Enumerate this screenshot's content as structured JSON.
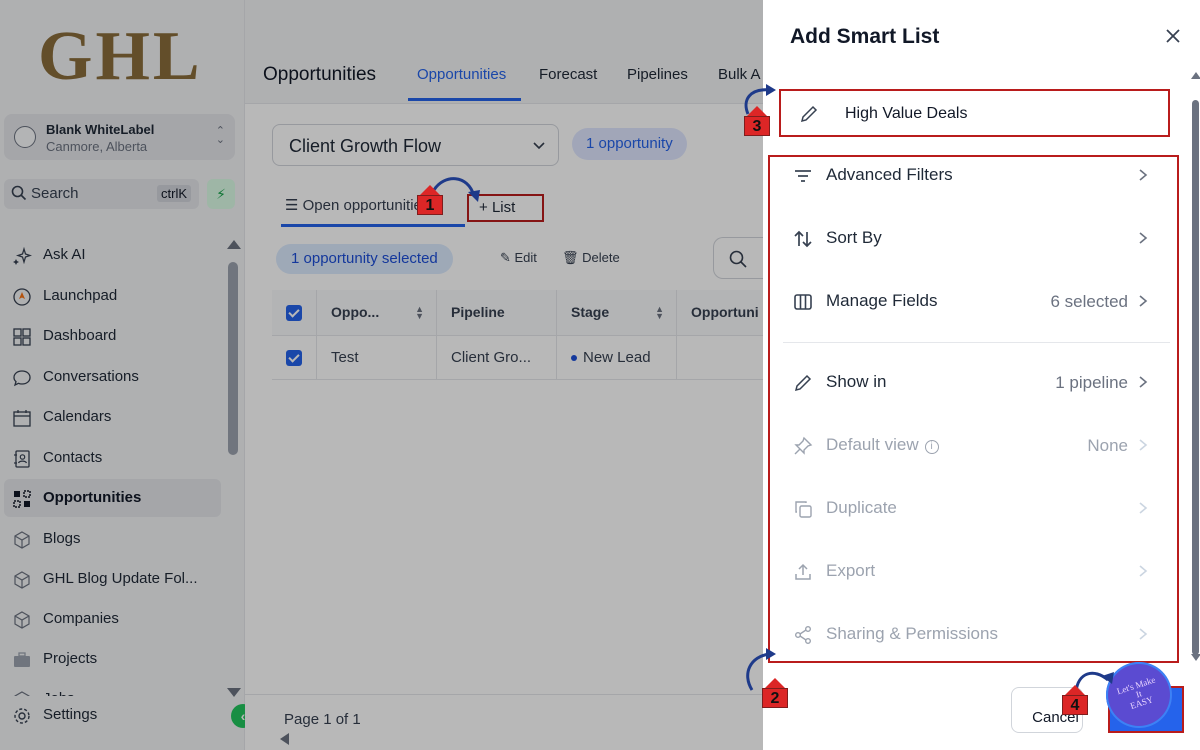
{
  "brand": {
    "logo_text": "GHL"
  },
  "account": {
    "name": "Blank WhiteLabel",
    "location": "Canmore, Alberta"
  },
  "sidebar": {
    "search_label": "Search",
    "shortcut": "ctrlK",
    "items": [
      {
        "label": "Ask AI",
        "icon": "sparkle-icon"
      },
      {
        "label": "Launchpad",
        "icon": "rocket-icon"
      },
      {
        "label": "Dashboard",
        "icon": "grid-icon"
      },
      {
        "label": "Conversations",
        "icon": "chat-icon"
      },
      {
        "label": "Calendars",
        "icon": "calendar-icon"
      },
      {
        "label": "Contacts",
        "icon": "contacts-icon"
      },
      {
        "label": "Opportunities",
        "icon": "opportunities-icon",
        "active": true
      },
      {
        "label": "Blogs",
        "icon": "cube-icon"
      },
      {
        "label": "GHL Blog Update Fol...",
        "icon": "cube-icon"
      },
      {
        "label": "Companies",
        "icon": "cube-icon"
      },
      {
        "label": "Projects",
        "icon": "briefcase-icon"
      },
      {
        "label": "Jobs",
        "icon": "cube-icon"
      }
    ],
    "settings_label": "Settings"
  },
  "header": {
    "title": "Opportunities",
    "tabs": [
      "Opportunities",
      "Forecast",
      "Pipelines",
      "Bulk A"
    ]
  },
  "toolbar": {
    "pipeline_select": "Client Growth Flow",
    "count_pill": "1 opportunity",
    "subtab_label": "Open opportunities",
    "add_list_label": "List",
    "selected_pill": "1 opportunity selected",
    "edit_label": "Edit",
    "delete_label": "Delete"
  },
  "table": {
    "columns": [
      "Oppo...",
      "Pipeline",
      "Stage",
      "Opportuni"
    ],
    "rows": [
      {
        "name": "Test",
        "pipeline": "Client Gro...",
        "stage": "New Lead"
      }
    ]
  },
  "pager": {
    "text": "Page 1 of 1"
  },
  "panel": {
    "title": "Add Smart List",
    "name_value": "High Value Deals",
    "options": [
      {
        "label": "Advanced Filters",
        "value": "",
        "icon": "filter-icon"
      },
      {
        "label": "Sort By",
        "value": "",
        "icon": "sort-icon"
      },
      {
        "label": "Manage Fields",
        "value": "6 selected",
        "icon": "columns-icon"
      },
      {
        "label": "Show in",
        "value": "1 pipeline",
        "icon": "pencil-icon"
      },
      {
        "label": "Default view",
        "value": "None",
        "icon": "pin-icon"
      },
      {
        "label": "Duplicate",
        "value": "",
        "icon": "copy-icon"
      },
      {
        "label": "Export",
        "value": "",
        "icon": "upload-icon"
      },
      {
        "label": "Sharing & Permissions",
        "value": "",
        "icon": "share-icon"
      }
    ],
    "cancel_label": "Cancel",
    "badge_text_1": "Let's Make",
    "badge_text_2": "It",
    "badge_text_3": "EASY"
  },
  "annotations": [
    "1",
    "2",
    "3",
    "4"
  ],
  "colors": {
    "accent": "#2563eb",
    "highlight": "#b91c1c",
    "success": "#22c55e"
  }
}
